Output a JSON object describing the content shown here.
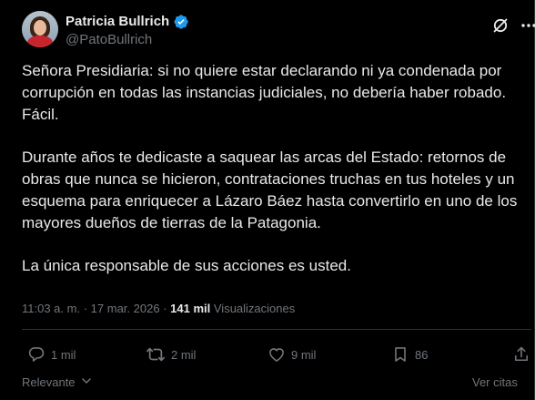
{
  "author": {
    "name": "Patricia Bullrich",
    "handle": "@PatoBullrich",
    "verified": true
  },
  "tweet": {
    "paragraphs": [
      "Señora Presidiaria: si no quiere estar declarando ni ya condenada por corrupción en todas las instancias judiciales, no debería haber robado. Fácil.",
      "Durante años te dedicaste a saquear las arcas del Estado: retornos de obras que nunca se hicieron, contrataciones truchas en tus hoteles y un esquema para enriquecer a Lázaro Báez hasta convertirlo en uno de los mayores dueños de tierras de la Patagonia.",
      "La única responsable de sus acciones es usted."
    ]
  },
  "meta": {
    "time": "11:03 a. m.",
    "separator": "·",
    "date": "17 mar. 2026",
    "views_count": "141 mil",
    "views_label": "Visualizaciones"
  },
  "actions": {
    "reply_count": "1 mil",
    "repost_count": "2 mil",
    "like_count": "9 mil",
    "bookmark_count": "86"
  },
  "footer": {
    "sort_label": "Relevante",
    "quotes_label": "Ver citas"
  },
  "icons": {
    "verified": "verified-badge-icon",
    "grok": "grok-icon",
    "more": "more-options-icon",
    "reply": "reply-icon",
    "repost": "repost-icon",
    "like": "heart-icon",
    "bookmark": "bookmark-icon",
    "share": "share-icon",
    "sort": "chevron-down-icon"
  },
  "colors": {
    "background": "#000000",
    "text": "#e7e9ea",
    "secondary": "#71767b",
    "border": "#2f3336",
    "verified": "#1d9bf0"
  }
}
